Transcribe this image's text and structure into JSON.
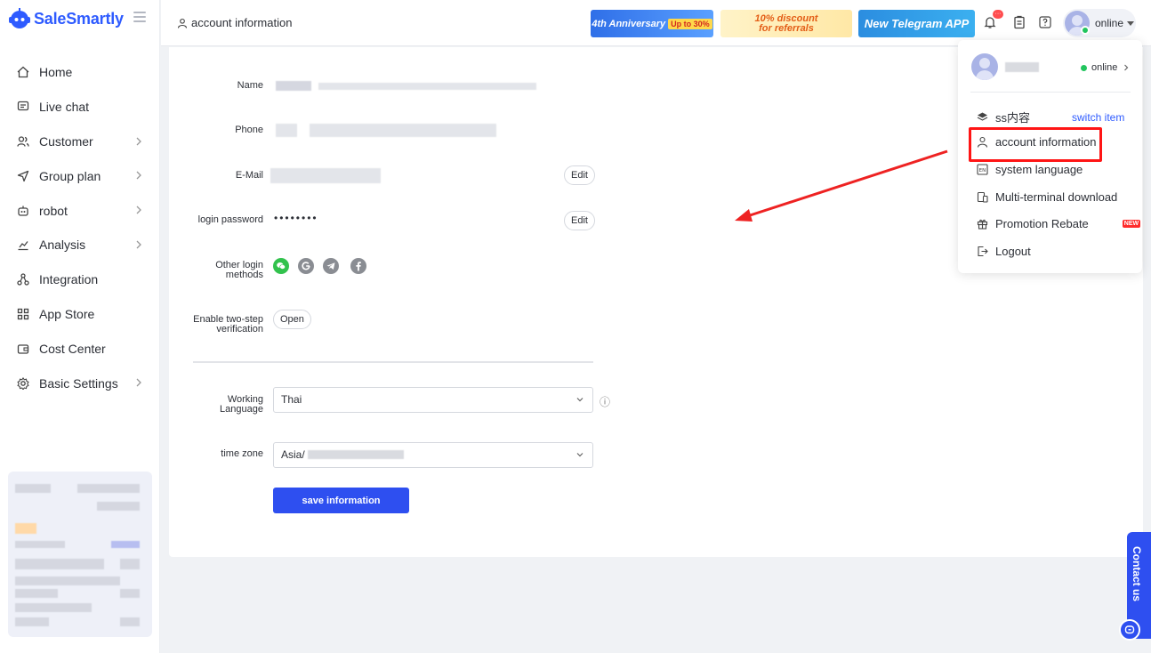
{
  "brand": {
    "name": "SaleSmartly",
    "color": "#2e5bff"
  },
  "sidebar": {
    "items": [
      {
        "label": "Home",
        "icon": "home-icon",
        "chevron": false
      },
      {
        "label": "Live chat",
        "icon": "chat-icon",
        "chevron": false
      },
      {
        "label": "Customer",
        "icon": "users-icon",
        "chevron": true
      },
      {
        "label": "Group plan",
        "icon": "send-icon",
        "chevron": true
      },
      {
        "label": "robot",
        "icon": "robot-icon",
        "chevron": true
      },
      {
        "label": "Analysis",
        "icon": "chart-icon",
        "chevron": true
      },
      {
        "label": "Integration",
        "icon": "integration-icon",
        "chevron": false
      },
      {
        "label": "App Store",
        "icon": "grid-icon",
        "chevron": false
      },
      {
        "label": "Cost Center",
        "icon": "wallet-icon",
        "chevron": false
      },
      {
        "label": "Basic Settings",
        "icon": "gear-icon",
        "chevron": true
      }
    ]
  },
  "header": {
    "breadcrumb": "account information",
    "banners": {
      "anniversary": {
        "text": "4th Anniversary",
        "tag": "Up to 30%"
      },
      "discount": {
        "line1": "10% discount",
        "line2": "for referrals"
      },
      "telegram": {
        "text": "New Telegram APP"
      }
    },
    "notification_badge": "···",
    "status": "online"
  },
  "form": {
    "name_label": "Name",
    "phone_label": "Phone",
    "email_label": "E-Mail",
    "email_edit": "Edit",
    "password_label": "login password",
    "password_mask": "••••••••",
    "password_edit": "Edit",
    "other_login_label_1": "Other login",
    "other_login_label_2": "methods",
    "twostep_label_1": "Enable two-step",
    "twostep_label_2": "verification",
    "twostep_button": "Open",
    "working_language_label_1": "Working",
    "working_language_label_2": "Language",
    "working_language_value": "Thai",
    "info_icon": "ⓘ",
    "timezone_label": "time zone",
    "timezone_value": "Asia/",
    "save_button": "save information"
  },
  "menu": {
    "status": "online",
    "items": [
      {
        "label": "ss内容",
        "extra": "switch item",
        "icon": "layers-icon"
      },
      {
        "label": "account information",
        "icon": "user-icon"
      },
      {
        "label": "system language",
        "icon": "language-icon"
      },
      {
        "label": "Multi-terminal download",
        "icon": "devices-icon"
      },
      {
        "label": "Promotion Rebate",
        "icon": "gift-icon",
        "tag": "NEW"
      },
      {
        "label": "Logout",
        "icon": "logout-icon"
      }
    ]
  },
  "contact": {
    "label": "Contact us"
  }
}
